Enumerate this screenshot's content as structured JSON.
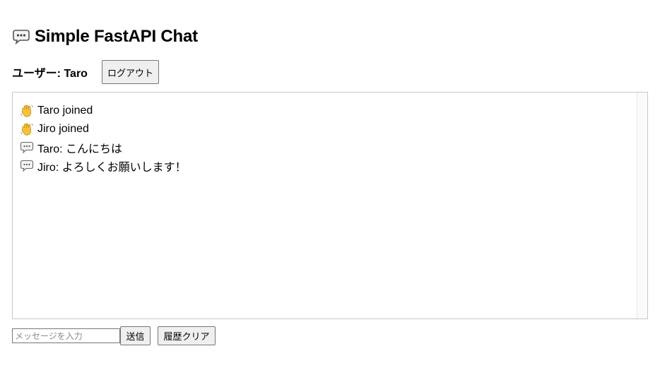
{
  "header": {
    "icon": "speech-bubble-icon",
    "title": "Simple FastAPI Chat"
  },
  "user_bar": {
    "user_label": "ユーザー: Taro",
    "logout_label": "ログアウト"
  },
  "messages": [
    {
      "icon": "waving-hand-icon",
      "text": "Taro joined"
    },
    {
      "icon": "waving-hand-icon",
      "text": "Jiro joined"
    },
    {
      "icon": "speech-bubble-icon",
      "text": "Taro: こんにちは"
    },
    {
      "icon": "speech-bubble-icon",
      "text": "Jiro: よろしくお願いします！"
    }
  ],
  "composer": {
    "input_value": "",
    "input_placeholder": "メッセージを入力",
    "send_label": "送信",
    "clear_label": "履歴クリア"
  },
  "colors": {
    "hand": "#f5c33b",
    "bubble_border": "#555555",
    "bubble_fill": "#f4f4f4"
  }
}
